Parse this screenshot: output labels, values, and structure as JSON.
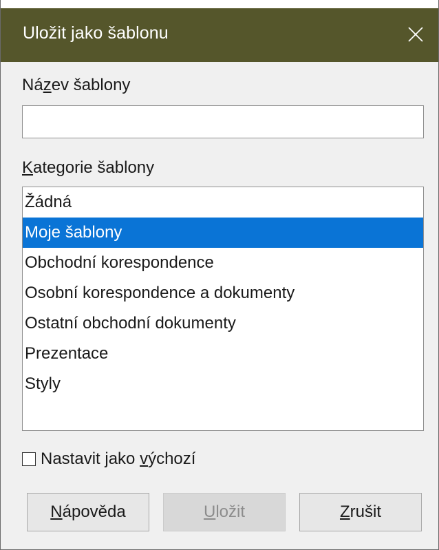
{
  "window": {
    "title": "Uložit jako šablonu",
    "close_icon": "close-icon"
  },
  "name_field": {
    "label_pre": "Ná",
    "label_mnemonic": "z",
    "label_post": "ev šablony",
    "value": "",
    "placeholder": ""
  },
  "category": {
    "label_mnemonic": "K",
    "label_post": "ategorie šablony",
    "items": [
      {
        "label": "Žádná"
      },
      {
        "label": "Moje šablony"
      },
      {
        "label": "Obchodní korespondence"
      },
      {
        "label": "Osobní korespondence a dokumenty"
      },
      {
        "label": "Ostatní obchodní dokumenty"
      },
      {
        "label": "Prezentace"
      },
      {
        "label": "Styly"
      }
    ],
    "selected_index": 1
  },
  "default_checkbox": {
    "label_pre": "Nastavit jako ",
    "label_mnemonic": "v",
    "label_post": "ýchozí",
    "checked": false
  },
  "buttons": {
    "help": {
      "mnemonic": "N",
      "rest": "ápověda"
    },
    "save": {
      "mnemonic": "U",
      "rest": "ložit",
      "disabled": true
    },
    "cancel": {
      "mnemonic": "Z",
      "rest": "rušit"
    }
  },
  "colors": {
    "titlebar": "#55562b",
    "selection": "#0a74d6"
  }
}
